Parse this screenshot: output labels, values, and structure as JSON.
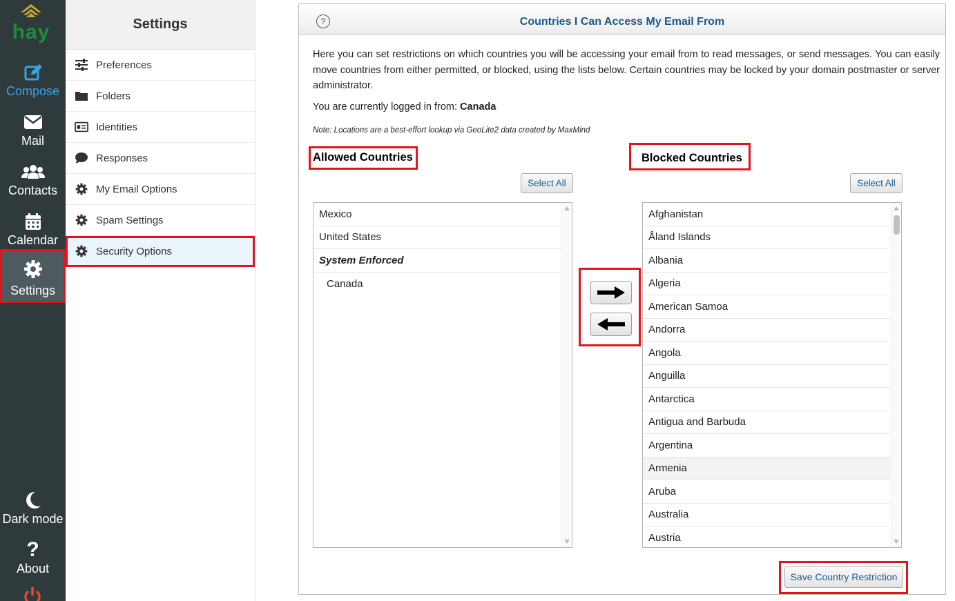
{
  "rail": {
    "logo_text": "hay",
    "items": [
      {
        "label": "Compose",
        "icon": "edit-icon"
      },
      {
        "label": "Mail",
        "icon": "envelope-icon"
      },
      {
        "label": "Contacts",
        "icon": "users-icon"
      },
      {
        "label": "Calendar",
        "icon": "calendar-icon"
      },
      {
        "label": "Settings",
        "icon": "gear-icon"
      }
    ],
    "bottom": [
      {
        "label": "Dark mode",
        "icon": "moon-icon"
      },
      {
        "label": "About",
        "icon": "question-icon"
      }
    ],
    "colors": {
      "background": "#2f3a3d",
      "accent": "#3aa3e3",
      "power": "#e04a3a"
    }
  },
  "sidebar": {
    "title": "Settings",
    "items": [
      {
        "label": "Preferences",
        "icon": "sliders-icon"
      },
      {
        "label": "Folders",
        "icon": "folder-icon"
      },
      {
        "label": "Identities",
        "icon": "id-card-icon"
      },
      {
        "label": "Responses",
        "icon": "comment-icon"
      },
      {
        "label": "My Email Options",
        "icon": "gear-icon"
      },
      {
        "label": "Spam Settings",
        "icon": "gear-icon"
      },
      {
        "label": "Security Options",
        "icon": "gear-icon"
      }
    ]
  },
  "panel": {
    "help_label": "?",
    "title": "Countries I Can Access My Email From",
    "intro": "Here you can set restrictions on which countries you will be accessing your email from to read messages, or send messages. You can easily move countries from either permitted, or blocked, using the lists below. Certain countries may be locked by your domain postmaster or server administrator.",
    "logged_prefix": "You are currently logged in from:",
    "logged_country": "Canada",
    "note": "Note: Locations are a best-effort lookup via GeoLite2 data created by MaxMind",
    "allowed": {
      "title": "Allowed Countries",
      "select_all": "Select All",
      "items": [
        "Mexico",
        "United States"
      ],
      "group_label": "System Enforced",
      "group_items": [
        "Canada"
      ]
    },
    "blocked": {
      "title": "Blocked Countries",
      "select_all": "Select All",
      "items": [
        "Afghanistan",
        "Åland Islands",
        "Albania",
        "Algeria",
        "American Samoa",
        "Andorra",
        "Angola",
        "Anguilla",
        "Antarctica",
        "Antigua and Barbuda",
        "Argentina",
        "Armenia",
        "Aruba",
        "Australia",
        "Austria"
      ],
      "highlighted": "Armenia"
    },
    "move_right_icon": "arrow-right-icon",
    "move_left_icon": "arrow-left-icon",
    "save_label": "Save Country Restriction"
  }
}
